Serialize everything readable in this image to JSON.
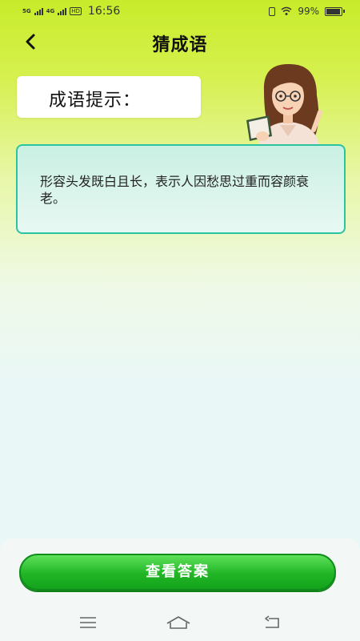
{
  "status_bar": {
    "net1": "5G",
    "net2": "4G",
    "hd": "HD",
    "time": "16:56",
    "battery_text": "99%",
    "battery_level_percent": 99
  },
  "header": {
    "title": "猜成语",
    "back_icon": "chevron-left-icon"
  },
  "hint": {
    "label": "成语提示：",
    "text": "形容头发既白且长，表示人因愁思过重而容颜衰老。"
  },
  "actions": {
    "answer_label": "查看答案"
  },
  "nav": {
    "menu_icon": "menu-icon",
    "home_icon": "home-icon",
    "back_icon": "back-icon"
  },
  "colors": {
    "accent": "#21b626",
    "card_border": "#2bc4a0",
    "top": "#c8ec2a"
  }
}
